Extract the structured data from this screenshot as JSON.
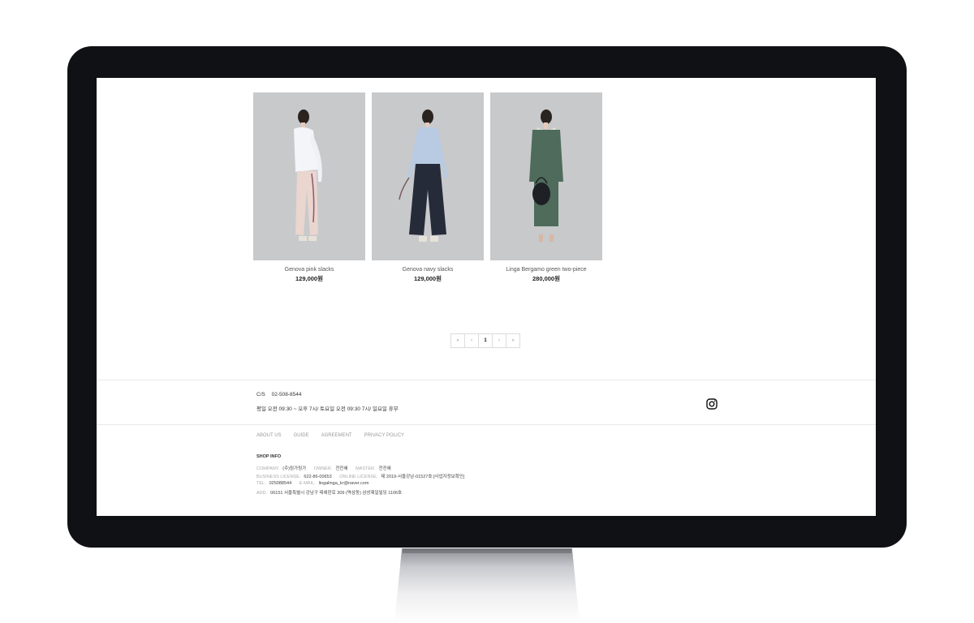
{
  "products": [
    {
      "name": "Genova pink slacks",
      "price": "129,000원"
    },
    {
      "name": "Genova navy slacks",
      "price": "129,000원"
    },
    {
      "name": "Linga Bergamo green two-piece",
      "price": "280,000원"
    }
  ],
  "pagination": {
    "first": "«",
    "prev": "‹",
    "current": "1",
    "next": "›",
    "last": "»"
  },
  "cs": {
    "label": "C/S",
    "phone": "02-508-8544",
    "hours": "평일 오전 09:30 ~ 오후 7시/ 토요일 오전 09:30 7시/ 일요일 휴무"
  },
  "footer_links": [
    "ABOUT US",
    "GUIDE",
    "AGREEMENT",
    "PRIVACY POLICY"
  ],
  "shop_info": {
    "title": "SHOP INFO",
    "company_label": "COMPANY.",
    "company": "(주)링가링가",
    "owner_label": "OWNER.",
    "owner": "전진혜",
    "master_label": "MASTER.",
    "master": "전진혜",
    "business_label": "BUSINESS LICENSE.",
    "business": "622-86-00653",
    "online_label": "ONLINE LICENSE.",
    "online": "제 2019-서울강남-01527호 [사업자정보확인]",
    "tel_label": "TEL.",
    "tel": "025088544",
    "email_label": "E-MAIL.",
    "email": "lingalinga_kr@naver.com",
    "add_label": "ADD.",
    "add": "06151 서울특별시 강남구 테헤란로 309 (역삼동) 삼성제일빌딩 1106호"
  },
  "colors": {
    "bezel": "#101114",
    "photo_bg": "#c8c9cb",
    "jacket_green": "#4e6b5c",
    "navy": "#262b3a"
  },
  "icons": {
    "social": "instagram-icon"
  }
}
